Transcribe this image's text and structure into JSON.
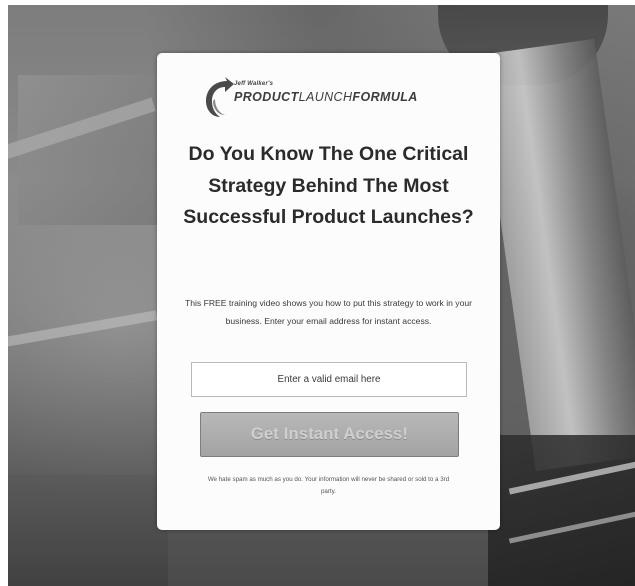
{
  "logo": {
    "small_text": "Jeff Walker's",
    "main_text_1": "PRODUCT",
    "main_text_2": "LAUNCH",
    "main_text_3": "FORMULA",
    "icon": "arrow-swirl-icon"
  },
  "headline": "Do You Know The One Critical Strategy Behind The Most Successful Product Launches?",
  "description": "This FREE training video shows you how to put this strategy to work in your business.  Enter your email address for instant access.",
  "email_field": {
    "placeholder": "Enter a valid email here",
    "value": ""
  },
  "cta_button": {
    "label": "Get Instant Access!"
  },
  "privacy_note": "We hate spam as much as you do. Your information will never be shared or sold to a 3rd party.",
  "colors": {
    "card_bg": "#fcfcfc",
    "headline": "#2b2b2b",
    "button_bg": "#a3a3a3",
    "button_text": "#cfcfcf"
  }
}
